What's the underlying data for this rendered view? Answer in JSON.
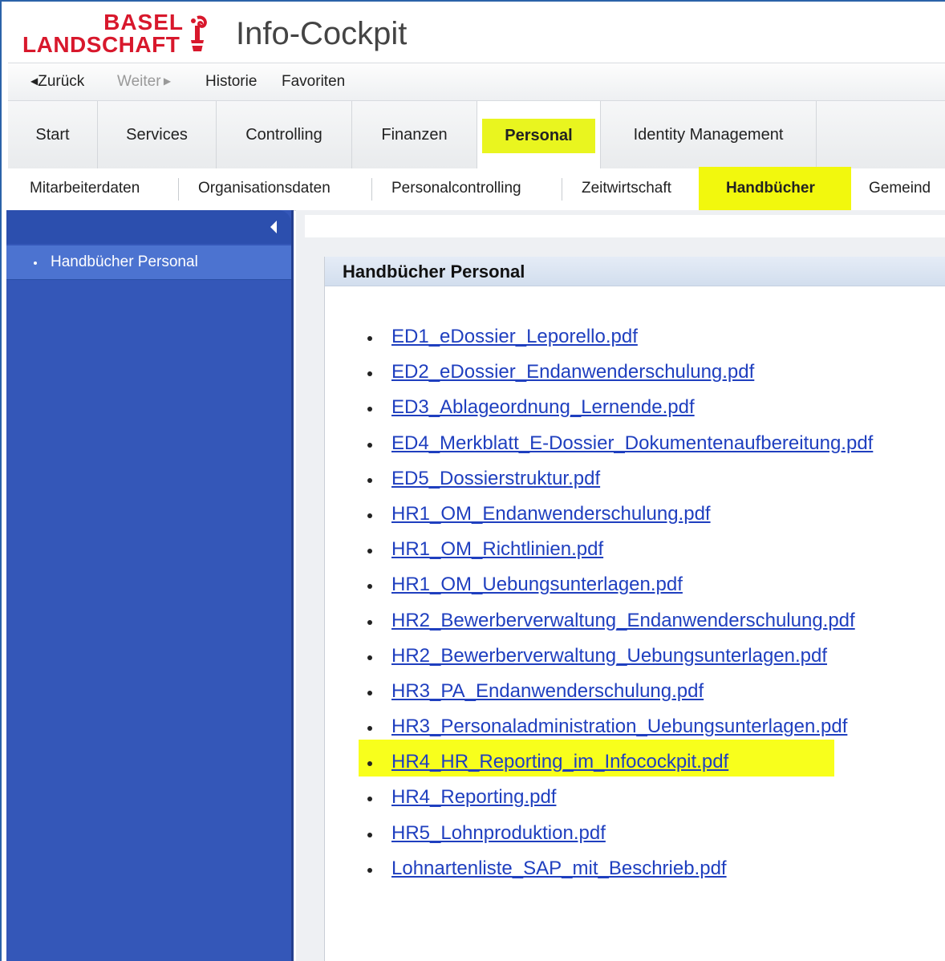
{
  "header": {
    "logo_line1": "BASEL",
    "logo_line2": "LANDSCHAFT",
    "app_title": "Info-Cockpit"
  },
  "nav": {
    "back": "Zurück",
    "forward": "Weiter",
    "history": "Historie",
    "favorites": "Favoriten"
  },
  "main_tabs": [
    {
      "label": "Start"
    },
    {
      "label": "Services"
    },
    {
      "label": "Controlling"
    },
    {
      "label": "Finanzen"
    },
    {
      "label": "Personal",
      "active": true
    },
    {
      "label": "Identity Management"
    }
  ],
  "sub_tabs": [
    {
      "label": "Mitarbeiterdaten"
    },
    {
      "label": "Organisationsdaten"
    },
    {
      "label": "Personalcontrolling"
    },
    {
      "label": "Zeitwirtschaft"
    },
    {
      "label": "Handbücher",
      "active": true
    },
    {
      "label": "Gemeind"
    }
  ],
  "sidebar": {
    "items": [
      {
        "label": "Handbücher Personal"
      }
    ]
  },
  "panel": {
    "title": "Handbücher Personal",
    "documents": [
      "ED1_eDossier_Leporello.pdf",
      "ED2_eDossier_Endanwenderschulung.pdf",
      "ED3_Ablageordnung_Lernende.pdf",
      "ED4_Merkblatt_E-Dossier_Dokumentenaufbereitung.pdf",
      "ED5_Dossierstruktur.pdf",
      "HR1_OM_Endanwenderschulung.pdf",
      "HR1_OM_Richtlinien.pdf",
      "HR1_OM_Uebungsunterlagen.pdf",
      "HR2_Bewerberverwaltung_Endanwenderschulung.pdf",
      "HR2_Bewerberverwaltung_Uebungsunterlagen.pdf",
      "HR3_PA_Endanwenderschulung.pdf",
      "HR3_Personaladministration_Uebungsunterlagen.pdf",
      "HR4_HR_Reporting_im_Infocockpit.pdf",
      "HR4_Reporting.pdf",
      "HR5_Lohnproduktion.pdf",
      "Lohnartenliste_SAP_mit_Beschrieb.pdf"
    ]
  },
  "colors": {
    "brand_red": "#d8182c",
    "sidebar_blue": "#3457b8",
    "link_blue": "#1f3fbf",
    "highlight_yellow": "#f2f80d"
  }
}
